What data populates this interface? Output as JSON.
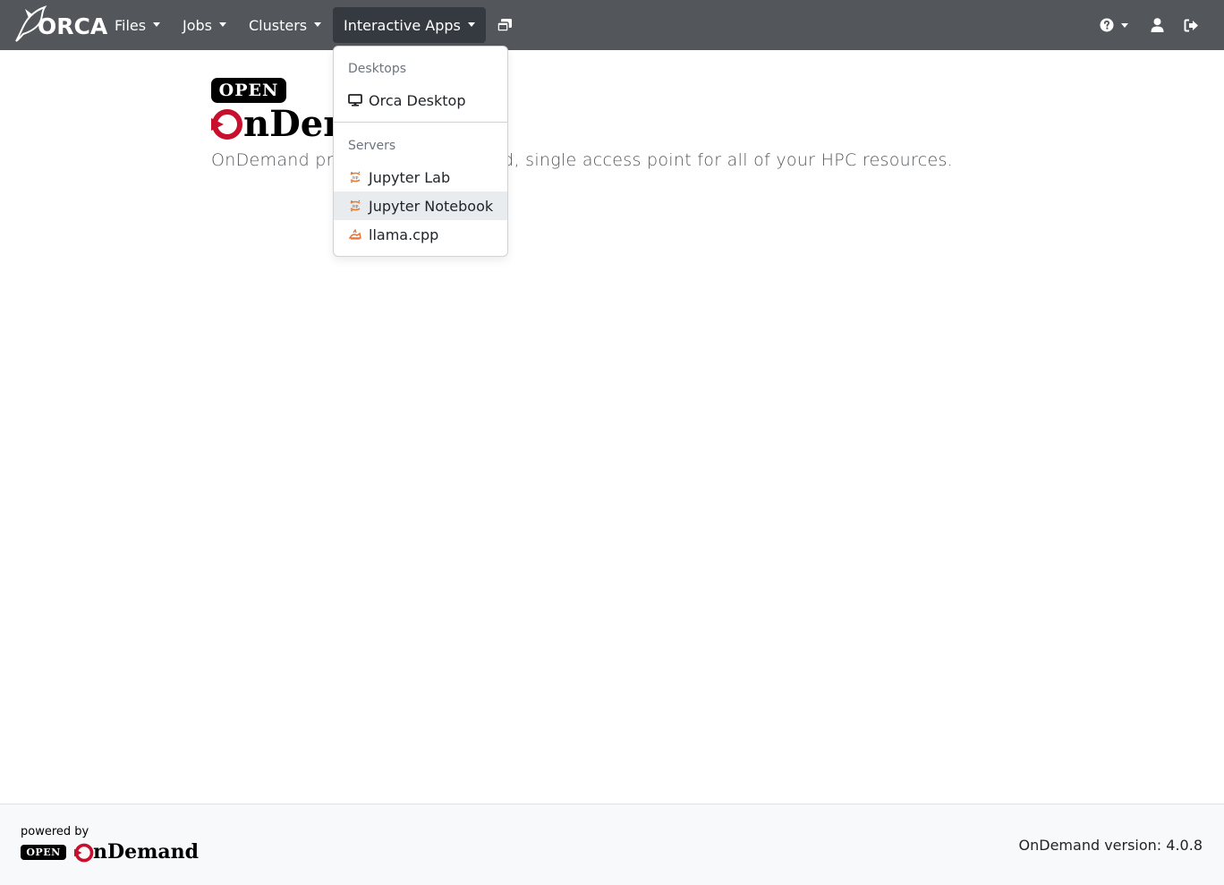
{
  "brand": {
    "name": "ORCA"
  },
  "nav": {
    "files": "Files",
    "jobs": "Jobs",
    "clusters": "Clusters",
    "interactive_apps": "Interactive Apps"
  },
  "dropdown": {
    "desktops_header": "Desktops",
    "orca_desktop": "Orca Desktop",
    "servers_header": "Servers",
    "jupyter_lab": "Jupyter Lab",
    "jupyter_notebook": "Jupyter Notebook",
    "llama_cpp": "llama.cpp"
  },
  "main": {
    "open_badge": "OPEN",
    "logo_text": "OnDemand",
    "tagline": "OnDemand provides an integrated, single access point for all of your HPC resources."
  },
  "footer": {
    "powered_by": "powered by",
    "open_badge": "OPEN",
    "logo_text": "OnDemand",
    "version": "OnDemand version: 4.0.8"
  },
  "colors": {
    "navbar": "#53565a",
    "active_nav": "#343a40",
    "ondemand_red": "#c8102e"
  },
  "icons": [
    "orca-logo-icon",
    "windows-icon",
    "help-icon",
    "user-icon",
    "logout-icon",
    "desktop-icon",
    "jupyter-icon",
    "llama-icon"
  ]
}
